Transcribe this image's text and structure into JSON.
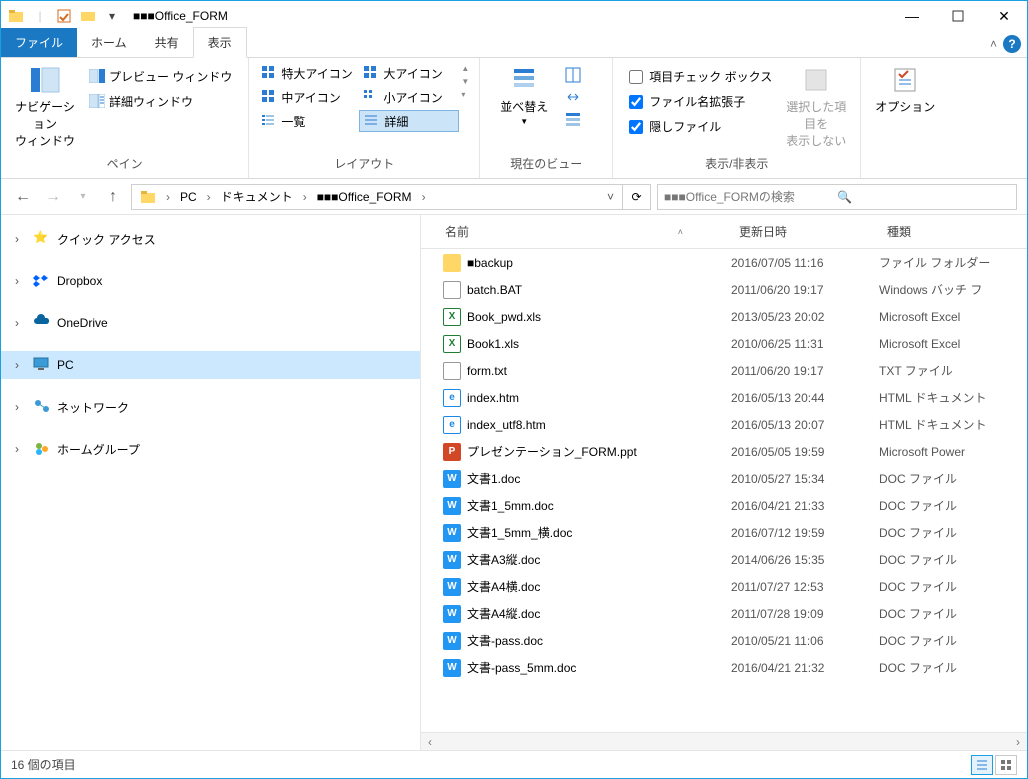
{
  "window": {
    "title": "■■■Office_FORM"
  },
  "tabs": {
    "file": "ファイル",
    "home": "ホーム",
    "share": "共有",
    "view": "表示"
  },
  "ribbon": {
    "panes": {
      "nav": "ナビゲーション\nウィンドウ",
      "preview": "プレビュー ウィンドウ",
      "details": "詳細ウィンドウ",
      "label": "ペイン"
    },
    "layout": {
      "xl": "特大アイコン",
      "l": "大アイコン",
      "m": "中アイコン",
      "s": "小アイコン",
      "list": "一覧",
      "detail": "詳細",
      "label": "レイアウト"
    },
    "currentview": {
      "sort": "並べ替え",
      "label": "現在のビュー"
    },
    "showhide": {
      "checkboxes": "項目チェック ボックス",
      "ext": "ファイル名拡張子",
      "hidden": "隠しファイル",
      "hideselected": "選択した項目を\n表示しない",
      "label": "表示/非表示"
    },
    "options": "オプション"
  },
  "breadcrumb": {
    "pc": "PC",
    "docs": "ドキュメント",
    "folder": "■■■Office_FORM"
  },
  "search": {
    "placeholder": "■■■Office_FORMの検索"
  },
  "tree": {
    "quick": "クイック アクセス",
    "dropbox": "Dropbox",
    "onedrive": "OneDrive",
    "pc": "PC",
    "network": "ネットワーク",
    "homegroup": "ホームグループ"
  },
  "columns": {
    "name": "名前",
    "date": "更新日時",
    "type": "種類"
  },
  "files": [
    {
      "ico": "folder",
      "name": "■backup",
      "date": "2016/07/05 11:16",
      "type": "ファイル フォルダー"
    },
    {
      "ico": "bat",
      "name": "batch.BAT",
      "date": "2011/06/20 19:17",
      "type": "Windows バッチ フ"
    },
    {
      "ico": "xls",
      "name": "Book_pwd.xls",
      "date": "2013/05/23 20:02",
      "type": "Microsoft Excel "
    },
    {
      "ico": "xls",
      "name": "Book1.xls",
      "date": "2010/06/25 11:31",
      "type": "Microsoft Excel "
    },
    {
      "ico": "txt",
      "name": "form.txt",
      "date": "2011/06/20 19:17",
      "type": "TXT ファイル"
    },
    {
      "ico": "htm",
      "name": "index.htm",
      "date": "2016/05/13 20:44",
      "type": "HTML ドキュメント"
    },
    {
      "ico": "htm",
      "name": "index_utf8.htm",
      "date": "2016/05/13 20:07",
      "type": "HTML ドキュメント"
    },
    {
      "ico": "ppt",
      "name": "プレゼンテーション_FORM.ppt",
      "date": "2016/05/05 19:59",
      "type": "Microsoft Power"
    },
    {
      "ico": "doc",
      "name": "文書1.doc",
      "date": "2010/05/27 15:34",
      "type": "DOC ファイル"
    },
    {
      "ico": "doc",
      "name": "文書1_5mm.doc",
      "date": "2016/04/21 21:33",
      "type": "DOC ファイル"
    },
    {
      "ico": "doc",
      "name": "文書1_5mm_横.doc",
      "date": "2016/07/12 19:59",
      "type": "DOC ファイル"
    },
    {
      "ico": "doc",
      "name": "文書A3縦.doc",
      "date": "2014/06/26 15:35",
      "type": "DOC ファイル"
    },
    {
      "ico": "doc",
      "name": "文書A4横.doc",
      "date": "2011/07/27 12:53",
      "type": "DOC ファイル"
    },
    {
      "ico": "doc",
      "name": "文書A4縦.doc",
      "date": "2011/07/28 19:09",
      "type": "DOC ファイル"
    },
    {
      "ico": "doc",
      "name": "文書-pass.doc",
      "date": "2010/05/21 11:06",
      "type": "DOC ファイル"
    },
    {
      "ico": "doc",
      "name": "文書-pass_5mm.doc",
      "date": "2016/04/21 21:32",
      "type": "DOC ファイル"
    }
  ],
  "status": {
    "count": "16 個の項目"
  }
}
